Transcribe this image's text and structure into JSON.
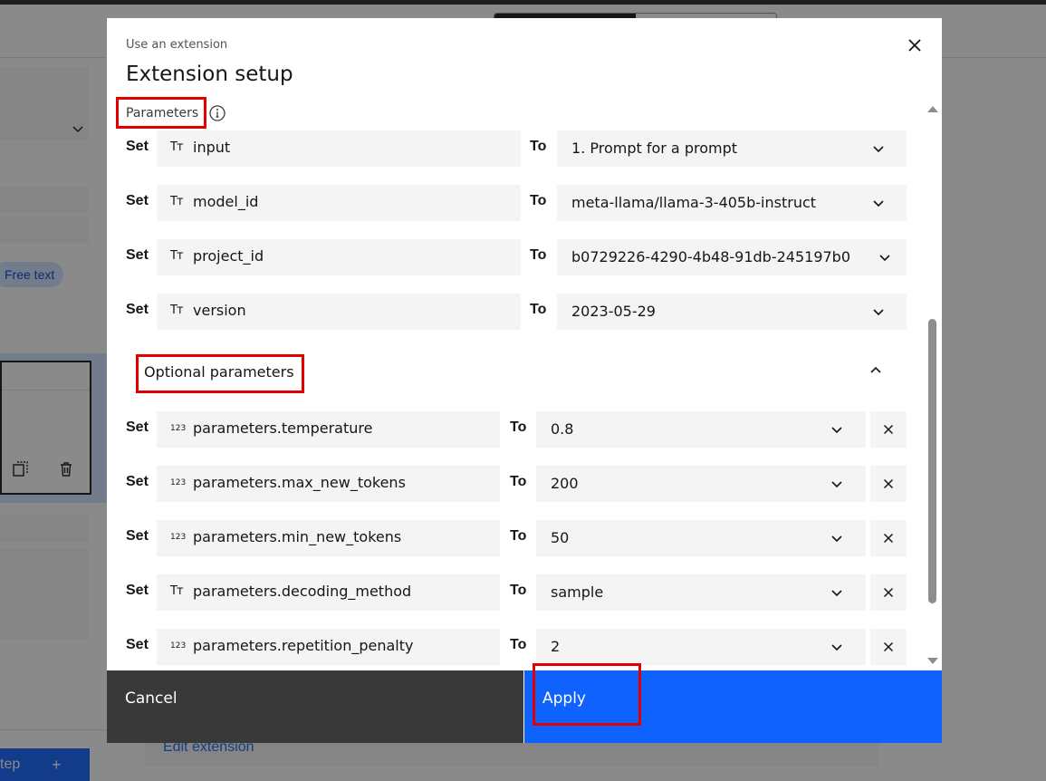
{
  "background": {
    "tag_label": "Free text",
    "step_label": "tep",
    "step_plus": "+",
    "edit_link": "Edit extension"
  },
  "modal": {
    "label": "Use an extension",
    "title": "Extension setup",
    "close_icon": "close-icon",
    "parameters_heading": "Parameters",
    "info_icon": "information-icon",
    "set_label": "Set",
    "to_label": "To",
    "parameters": [
      {
        "type": "text",
        "type_icon": "Tт",
        "name": "input",
        "value": "1. Prompt for a prompt"
      },
      {
        "type": "text",
        "type_icon": "Tт",
        "name": "model_id",
        "value": "meta-llama/llama-3-405b-instruct"
      },
      {
        "type": "text",
        "type_icon": "Tт",
        "name": "project_id",
        "value": "b0729226-4290-4b48-91db-245197b0"
      },
      {
        "type": "text",
        "type_icon": "Tт",
        "name": "version",
        "value": "2023-05-29"
      }
    ],
    "optional_heading": "Optional parameters",
    "optional_parameters": [
      {
        "type": "number",
        "type_icon": "123",
        "name": "parameters.temperature",
        "value": "0.8"
      },
      {
        "type": "number",
        "type_icon": "123",
        "name": "parameters.max_new_tokens",
        "value": "200"
      },
      {
        "type": "number",
        "type_icon": "123",
        "name": "parameters.min_new_tokens",
        "value": "50"
      },
      {
        "type": "text",
        "type_icon": "Tт",
        "name": "parameters.decoding_method",
        "value": "sample"
      },
      {
        "type": "number",
        "type_icon": "123",
        "name": "parameters.repetition_penalty",
        "value": "2"
      }
    ],
    "cancel_label": "Cancel",
    "apply_label": "Apply"
  },
  "colors": {
    "primary": "#0f62fe",
    "secondary_button": "#393939",
    "field_bg": "#f4f4f4",
    "highlight_box": "#e00000"
  }
}
